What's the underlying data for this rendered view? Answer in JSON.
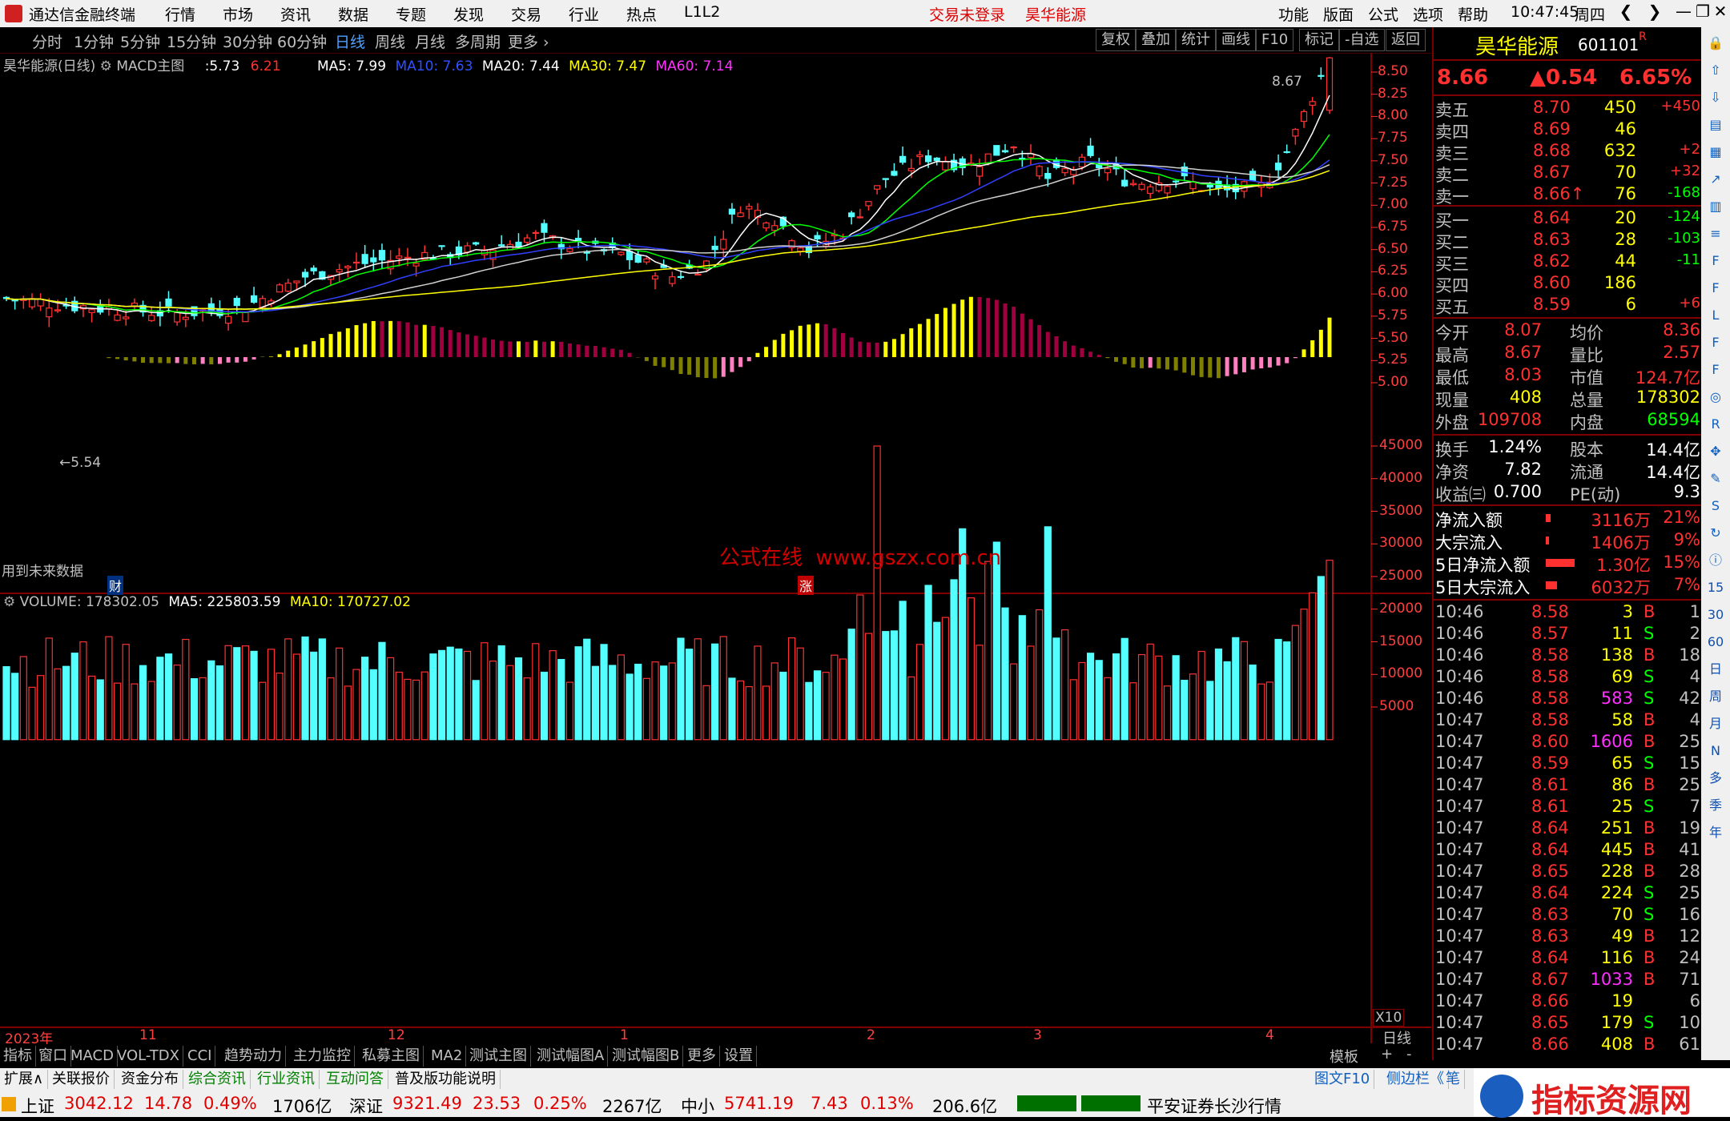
{
  "menubar": {
    "app_title": "通达信金融终端",
    "items": [
      "行情",
      "市场",
      "资讯",
      "数据",
      "专题",
      "发现",
      "交易",
      "行业",
      "热点",
      "L1L2"
    ],
    "status_red": [
      "交易未登录",
      "昊华能源"
    ],
    "right_items": [
      "功能",
      "版面",
      "公式",
      "选项",
      "帮助"
    ],
    "clock": "10:47:45",
    "weekday": "周四",
    "win_btns": [
      "❮",
      "❯",
      "—",
      "❐",
      "✕"
    ]
  },
  "period_bar": {
    "items": [
      "分时",
      "1分钟",
      "5分钟",
      "15分钟",
      "30分钟",
      "60分钟",
      "日线",
      "周线",
      "月线",
      "多周期",
      "更多 ›"
    ],
    "active": "日线",
    "right_buttons": [
      "复权",
      "叠加",
      "统计",
      "画线",
      "F10",
      "标记",
      "-自选",
      "返回"
    ]
  },
  "main_chart": {
    "legend": {
      "title": "昊华能源(日线)",
      "indicator": "MACD主图",
      "val1": ":5.73",
      "val2": "6.21",
      "ma5": "MA5: 7.99",
      "ma10": "MA10: 7.63",
      "ma20": "MA20: 7.44",
      "ma30": "MA30: 7.47",
      "ma60": "MA60: 7.14"
    },
    "price_ticks": [
      "8.50",
      "8.25",
      "8.00",
      "7.75",
      "7.50",
      "7.25",
      "7.00",
      "6.75",
      "6.50",
      "6.25",
      "6.00",
      "5.75",
      "5.50",
      "5.25",
      "5.00"
    ],
    "high_label": "8.67",
    "low_label": "←5.54",
    "future_note": "用到未来数据",
    "badge_cai": "财",
    "badge_zhang": "涨",
    "watermark": "公式在线  www.gszx.com.cn"
  },
  "volume_chart": {
    "legend": {
      "label": "VOLUME: 178302.05",
      "ma5": "MA5: 225803.59",
      "ma10": "MA10: 170727.02"
    },
    "ticks": [
      "45000",
      "40000",
      "35000",
      "30000",
      "25000",
      "20000",
      "15000",
      "10000",
      "5000"
    ],
    "unit": "X10"
  },
  "time_axis": {
    "labels": [
      "2023年",
      "11",
      "12",
      "1",
      "2",
      "3",
      "4"
    ],
    "period": "日线"
  },
  "chart_data": {
    "type": "candlestick+volume",
    "title": "昊华能源(日线)",
    "ohlc_range": [
      5.0,
      8.67
    ],
    "last_close": 8.66,
    "ma_latest": {
      "MA5": 7.99,
      "MA10": 7.63,
      "MA20": 7.44,
      "MA30": 7.47,
      "MA60": 7.14
    },
    "volume_ticks_ylim": [
      0,
      45000
    ],
    "volume_latest": 178302.05,
    "volume_ma5": 225803.59,
    "volume_ma10": 170727.02
  },
  "quote": {
    "name": "昊华能源",
    "code": "601101",
    "mark": "R",
    "price": "8.66",
    "change": "▲0.54",
    "pct": "6.65%",
    "asks": [
      {
        "label": "卖五",
        "price": "8.70",
        "vol": "450",
        "chg": "+450"
      },
      {
        "label": "卖四",
        "price": "8.69",
        "vol": "46",
        "chg": ""
      },
      {
        "label": "卖三",
        "price": "8.68",
        "vol": "632",
        "chg": "+2"
      },
      {
        "label": "卖二",
        "price": "8.67",
        "vol": "70",
        "chg": "+32"
      },
      {
        "label": "卖一",
        "price": "8.66↑",
        "vol": "76",
        "chg": "-168"
      }
    ],
    "bids": [
      {
        "label": "买一",
        "price": "8.64",
        "vol": "20",
        "chg": "-124"
      },
      {
        "label": "买二",
        "price": "8.63",
        "vol": "28",
        "chg": "-103"
      },
      {
        "label": "买三",
        "price": "8.62",
        "vol": "44",
        "chg": "-11"
      },
      {
        "label": "买四",
        "price": "8.60",
        "vol": "186",
        "chg": ""
      },
      {
        "label": "买五",
        "price": "8.59",
        "vol": "6",
        "chg": "+6"
      }
    ],
    "stats": [
      {
        "l1": "今开",
        "v1": "8.07",
        "l2": "均价",
        "v2": "8.36"
      },
      {
        "l1": "最高",
        "v1": "8.67",
        "l2": "量比",
        "v2": "2.57"
      },
      {
        "l1": "最低",
        "v1": "8.03",
        "l2": "市值",
        "v2": "124.7亿"
      },
      {
        "l1": "现量",
        "v1": "408",
        "l2": "总量",
        "v2": "178302"
      },
      {
        "l1": "外盘",
        "v1": "109708",
        "l2": "内盘",
        "v2": "68594"
      }
    ],
    "stats2": [
      {
        "l1": "换手",
        "v1": "1.24%",
        "l2": "股本",
        "v2": "14.4亿"
      },
      {
        "l1": "净资",
        "v1": "7.82",
        "l2": "流通",
        "v2": "14.4亿"
      },
      {
        "l1": "收益㈢",
        "v1": "0.700",
        "l2": "PE(动)",
        "v2": "9.3"
      }
    ],
    "flows": [
      {
        "label": "净流入额",
        "val": "3116万",
        "pct": "21%"
      },
      {
        "label": "大宗流入",
        "val": "1406万",
        "pct": "9%"
      },
      {
        "label": "5日净流入额",
        "val": "1.30亿",
        "pct": "15%"
      },
      {
        "label": "5日大宗流入",
        "val": "6032万",
        "pct": "7%"
      }
    ],
    "ticks": [
      {
        "t": "10:46",
        "p": "8.58",
        "v": "3",
        "s": "B",
        "n": "1"
      },
      {
        "t": "10:46",
        "p": "8.57",
        "v": "11",
        "s": "S",
        "n": "2"
      },
      {
        "t": "10:46",
        "p": "8.58",
        "v": "138",
        "s": "B",
        "n": "18"
      },
      {
        "t": "10:46",
        "p": "8.58",
        "v": "69",
        "s": "S",
        "n": "4"
      },
      {
        "t": "10:46",
        "p": "8.58",
        "v": "583",
        "s": "S",
        "n": "42"
      },
      {
        "t": "10:47",
        "p": "8.58",
        "v": "58",
        "s": "B",
        "n": "4"
      },
      {
        "t": "10:47",
        "p": "8.60",
        "v": "1606",
        "s": "B",
        "n": "25"
      },
      {
        "t": "10:47",
        "p": "8.59",
        "v": "65",
        "s": "S",
        "n": "15"
      },
      {
        "t": "10:47",
        "p": "8.61",
        "v": "86",
        "s": "B",
        "n": "25"
      },
      {
        "t": "10:47",
        "p": "8.61",
        "v": "25",
        "s": "S",
        "n": "7"
      },
      {
        "t": "10:47",
        "p": "8.64",
        "v": "251",
        "s": "B",
        "n": "19"
      },
      {
        "t": "10:47",
        "p": "8.64",
        "v": "445",
        "s": "B",
        "n": "41"
      },
      {
        "t": "10:47",
        "p": "8.65",
        "v": "228",
        "s": "B",
        "n": "28"
      },
      {
        "t": "10:47",
        "p": "8.64",
        "v": "224",
        "s": "S",
        "n": "25"
      },
      {
        "t": "10:47",
        "p": "8.63",
        "v": "70",
        "s": "S",
        "n": "16"
      },
      {
        "t": "10:47",
        "p": "8.63",
        "v": "49",
        "s": "B",
        "n": "12"
      },
      {
        "t": "10:47",
        "p": "8.64",
        "v": "116",
        "s": "B",
        "n": "24"
      },
      {
        "t": "10:47",
        "p": "8.67",
        "v": "1033",
        "s": "B",
        "n": "71"
      },
      {
        "t": "10:47",
        "p": "8.66",
        "v": "19",
        "s": "",
        "n": "6"
      },
      {
        "t": "10:47",
        "p": "8.65",
        "v": "179",
        "s": "S",
        "n": "10"
      },
      {
        "t": "10:47",
        "p": "8.66",
        "v": "408",
        "s": "B",
        "n": "61"
      }
    ]
  },
  "bottom_tabs": [
    "指标",
    "窗口",
    "MACD",
    "VOL-TDX",
    "CCI",
    "趋势动力",
    "主力监控",
    "私募主图",
    "MA2",
    "测试主图",
    "测试幅图A",
    "测试幅图B",
    "更多",
    "设置"
  ],
  "bottom_right": [
    "模板",
    "+",
    "-"
  ],
  "info_tabs": [
    "扩展∧",
    "关联报价",
    "资金分布",
    "综合资讯",
    "行业资讯",
    "互动问答",
    "普及版功能说明"
  ],
  "info_right": [
    "图文F10",
    "侧边栏《",
    "笔"
  ],
  "status": {
    "sh_label": "上证",
    "sh_val": "3042.12",
    "sh_chg": "14.78",
    "sh_pct": "0.49%",
    "sh_amt": "1706亿",
    "sz_label": "深证",
    "sz_val": "9321.49",
    "sz_chg": "23.53",
    "sz_pct": "0.25%",
    "sz_amt": "2267亿",
    "zx_label": "中小",
    "zx_val": "5741.19",
    "zx_chg": "7.43",
    "zx_pct": "0.13%",
    "zx_amt": "206.6亿",
    "broker": "平安证券长沙行情",
    "ad_text": "指标资源网"
  },
  "icon_column": [
    "lock-icon",
    "up-arrow-icon",
    "down-arrow-icon",
    "chart-icon",
    "grid-icon",
    "trend-icon",
    "bar-icon",
    "list-icon",
    "f10-icon",
    "f-icon",
    "l2-icon",
    "f1-icon",
    "f2-icon",
    "circle-icon",
    "rsi-icon",
    "cross-icon",
    "pen-icon",
    "fs-icon",
    "refresh-icon",
    "info-icon",
    "15",
    "30",
    "60",
    "日",
    "周",
    "月",
    "N",
    "多",
    "季",
    "年"
  ],
  "colors": {
    "up": "#ff3030",
    "down": "#54ffff",
    "ma5": "#ffffff",
    "ma10": "#ffff00",
    "ma20": "#ff00ff",
    "ma30": "#00ff00",
    "ma60": "#ffff00",
    "accent": "#ffff00"
  }
}
